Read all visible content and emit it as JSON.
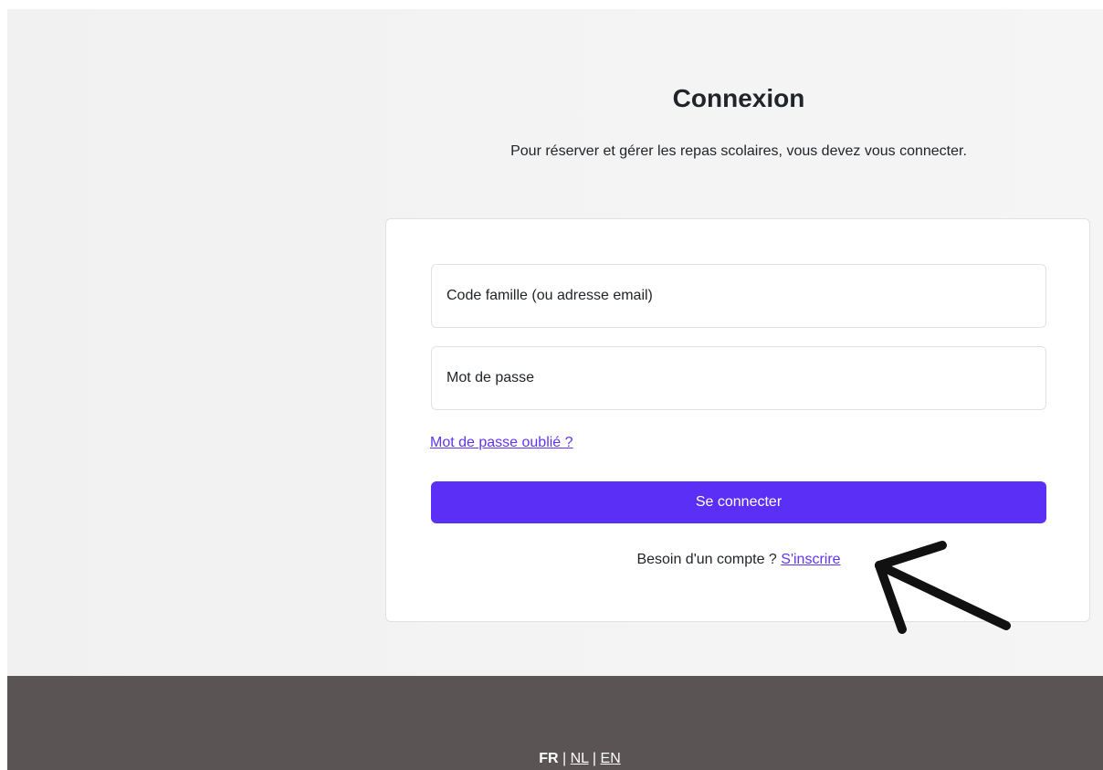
{
  "header": {
    "title": "Connexion",
    "subtitle": "Pour réserver et gérer les repas scolaires, vous devez vous connecter."
  },
  "form": {
    "code_placeholder": "Code famille (ou adresse email)",
    "code_value": "",
    "password_placeholder": "Mot de passe",
    "password_value": "",
    "forgot_label": "Mot de passe oublié ?",
    "submit_label": "Se connecter",
    "signup_prompt": "Besoin d'un compte ?",
    "signup_link": "S'inscrire"
  },
  "footer": {
    "languages": [
      {
        "label": "FR",
        "active": true
      },
      {
        "label": "NL",
        "active": false
      },
      {
        "label": "EN",
        "active": false
      }
    ],
    "separator": "|"
  },
  "annotation": {
    "icon": "arrow-up-left-icon",
    "color": "#111111"
  },
  "colors": {
    "accent": "#5b2ff5",
    "link": "#6134f5",
    "footer_bg": "#5a5454",
    "page_bg": "#f3f3f3"
  }
}
